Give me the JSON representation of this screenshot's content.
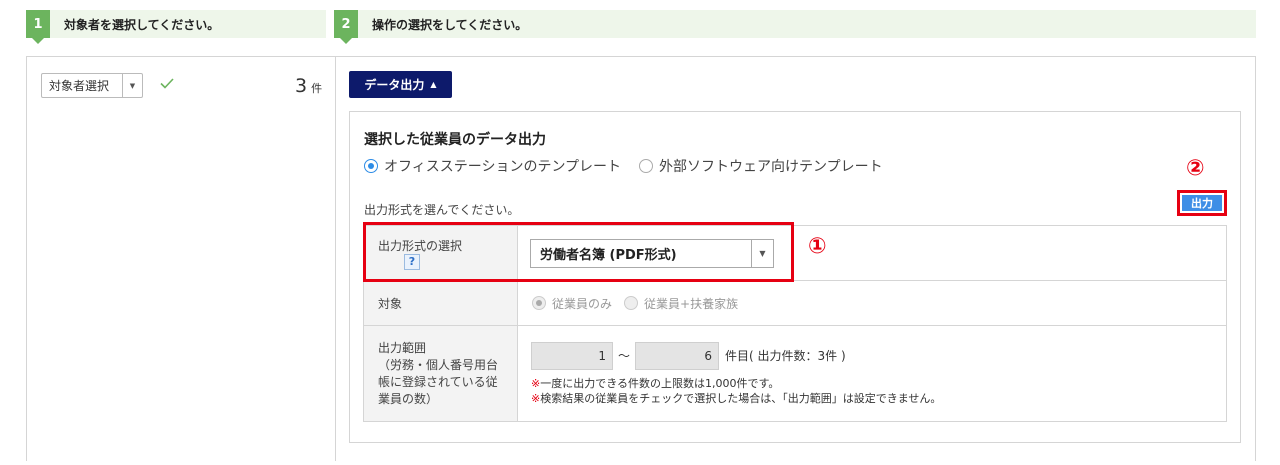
{
  "steps": [
    {
      "num": "1",
      "label": "対象者を選択してください。"
    },
    {
      "num": "2",
      "label": "操作の選択をしてください。"
    }
  ],
  "target": {
    "select_value": "対象者選択",
    "count": "3",
    "count_unit": "件"
  },
  "data_output_button": "データ出力",
  "panel": {
    "title": "選択した従業員のデータ出力",
    "template_options": [
      "オフィスステーションのテンプレート",
      "外部ソフトウェア向けテンプレート"
    ],
    "format_note": "出力形式を選んでください。",
    "output_button": "出力",
    "annotation_1": "①",
    "annotation_2": "②",
    "rows": {
      "format_label": "出力形式の選択",
      "help": "?",
      "format_value": "労働者名簿 (PDF形式)",
      "target_label": "対象",
      "target_options": [
        "従業員のみ",
        "従業員+扶養家族"
      ],
      "range_label_1": "出力範囲",
      "range_label_2": "（労務・個人番号用台",
      "range_label_3": "帳に登録されている従",
      "range_label_4": "業員の数）",
      "range_from": "1",
      "range_tilde": "～",
      "range_to": "6",
      "range_suffix": "件目( 出力件数：3件 )",
      "note_mark": "※",
      "note_1": "一度に出力できる件数の上限数は1,000件です。",
      "note_2": "検索結果の従業員をチェックで選択した場合は、「出力範囲」は設定できません。"
    }
  },
  "colors": {
    "accent_green": "#6cb45e",
    "navy": "#0d1a6b",
    "blue": "#3e8ee6",
    "red": "#e60012"
  }
}
